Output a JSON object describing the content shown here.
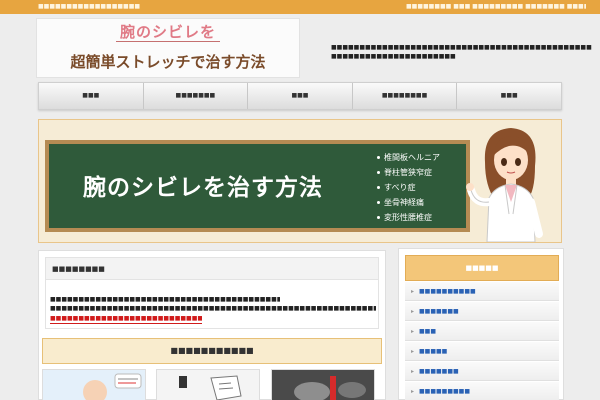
{
  "topbar": {
    "left_text": "■■■■■■■■■■■■■■■■■■",
    "right_text": "■■■■■■■■ ■■■ ■■■■■■■■■ ■■■■■■■ ■■■■■■■■■■■"
  },
  "header": {
    "logo_line1": "腕のシビレを",
    "logo_line2": "超簡単ストレッチで治す方法",
    "description": "■■■■■■■■■■■■■■■■■■■■■■■■■■■■■■■■■■■■■■■■■■■■■■■■■■■■■■■■■■■■■■■■■■■■"
  },
  "nav": {
    "items": [
      {
        "label": "■■■"
      },
      {
        "label": "■■■■■■■"
      },
      {
        "label": "■■■"
      },
      {
        "label": "■■■■■■■■"
      },
      {
        "label": "■■■"
      }
    ]
  },
  "hero": {
    "title": "腕のシビレを治す方法",
    "list": [
      "椎間板ヘルニア",
      "脊柱管狭窄症",
      "すべり症",
      "坐骨神経痛",
      "変形性腰椎症"
    ]
  },
  "main": {
    "intro_title": "■■■■■■■■",
    "intro_lines": [
      "■■■■■■■■■■■■■■■■■■■■■■■■■■■■■■■■■■■■■■■■■■■■■■■■■■■■■",
      "■■■■■■■■■■■■■■■■■■■■■■■■■■■■■■■■■■■■■■■■■■■■■■■■■■■■■■■■■■■■■■■■■■■■■■■■■■■■■■■■■■■■■■■",
      "■■■■■■■■■■■■■■■■■■■■■■■■■■■■■■■■■■■■■■■■■"
    ],
    "section_title": "■■■■■■■■■■■"
  },
  "sidebar": {
    "title": "■■■■■",
    "items": [
      {
        "label": "■■■■■■■■■■"
      },
      {
        "label": "■■■■■■■"
      },
      {
        "label": "■■■"
      },
      {
        "label": "■■■■■"
      },
      {
        "label": "■■■■■■■"
      },
      {
        "label": "■■■■■■■■■"
      }
    ]
  }
}
